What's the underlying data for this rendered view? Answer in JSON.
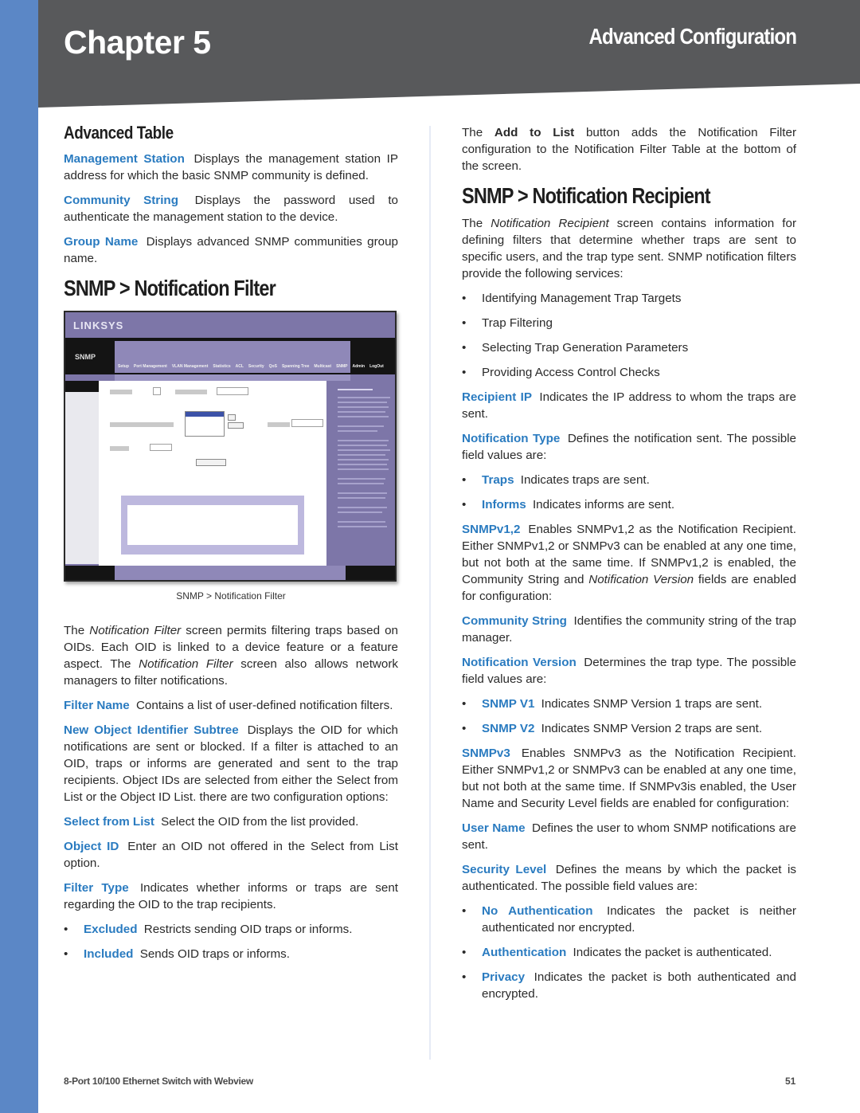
{
  "header": {
    "chapter": "Chapter 5",
    "section": "Advanced Configuration",
    "colors": {
      "band": "#58595b",
      "sidebar": "#5b87c6",
      "term": "#2a7bc0"
    }
  },
  "left": {
    "advanced_table": {
      "heading": "Advanced Table",
      "items": [
        {
          "term": "Management Station",
          "text": "Displays the management station IP address for which the basic SNMP community is defined."
        },
        {
          "term": "Community String",
          "text": "Displays the password used to authenticate the management station to the device."
        },
        {
          "term": "Group Name",
          "text": "Displays advanced SNMP communities group name."
        }
      ]
    },
    "notification_filter": {
      "heading": "SNMP > Notification Filter",
      "figure_caption": "SNMP > Notification Filter",
      "screenshot": {
        "logo": "LINKSYS",
        "page_label": "SNMP",
        "nav": [
          "Setup",
          "Port Management",
          "VLAN Management",
          "Statistics",
          "ACL",
          "Security",
          "QoS",
          "Spanning Tree",
          "Multicast",
          "SNMP",
          "Admin",
          "LogOut"
        ]
      },
      "intro": {
        "p1": "The ",
        "em1": "Notification Filter",
        "p2": " screen permits filtering traps based on OIDs. Each OID is linked to a device feature or a feature aspect. The ",
        "em2": "Notification Filter",
        "p3": " screen also allows network managers to filter notifications."
      },
      "items": [
        {
          "term": "Filter Name",
          "text": "Contains a list of user-defined notification filters."
        },
        {
          "term": "New Object Identifier Subtree",
          "text": "Displays the OID for which notifications are sent or blocked. If a filter is attached to an OID, traps or informs are generated and sent to the trap recipients. Object IDs are selected from either the Select from List or the Object ID List. there are two configuration options:"
        },
        {
          "term": "Select from List",
          "text": "Select the OID from the list provided."
        },
        {
          "term": "Object ID",
          "text": "Enter an OID not offered in the Select from List option."
        },
        {
          "term": "Filter Type",
          "text": "Indicates whether informs or traps are sent regarding the OID to the trap recipients."
        }
      ],
      "filter_type_bullets": [
        {
          "term": "Excluded",
          "text": "Restricts sending OID traps or informs."
        },
        {
          "term": "Included",
          "text": "Sends OID traps or informs."
        }
      ]
    }
  },
  "right": {
    "add_to_list": {
      "p1": "The ",
      "bold": "Add to List",
      "p2": " button adds the Notification Filter configuration to the Notification Filter Table at the bottom of the screen."
    },
    "recipient": {
      "heading": "SNMP > Notification Recipient",
      "intro": {
        "p1": "The ",
        "em": "Notification Recipient",
        "p2": " screen contains information for defining filters that determine whether traps are sent to specific users, and the trap type sent. SNMP notification filters provide the following services:"
      },
      "services": [
        "Identifying Management Trap Targets",
        "Trap Filtering",
        "Selecting Trap Generation Parameters",
        "Providing Access Control Checks"
      ],
      "recipient_ip": {
        "term": "Recipient IP",
        "text": "Indicates the IP address to whom the traps are sent."
      },
      "notification_type": {
        "term": "Notification Type",
        "text": "Defines the notification sent. The possible field values are:"
      },
      "notification_type_bullets": [
        {
          "term": "Traps",
          "text": "Indicates traps are sent."
        },
        {
          "term": "Informs",
          "text": "Indicates informs are sent."
        }
      ],
      "snmpv12": {
        "term": "SNMPv1,2",
        "p1": "Enables SNMPv1,2 as the Notification Recipient. Either SNMPv1,2 or SNMPv3 can be enabled at any one time, but not both at the same time. If SNMPv1,2 is enabled, the Community String and ",
        "em": "Notification Version",
        "p2": " fields are enabled for configuration:"
      },
      "community_string": {
        "term": "Community String",
        "text": "Identifies the community string of the trap manager."
      },
      "notification_version": {
        "term": "Notification Version",
        "text": "Determines the trap type. The possible field values are:"
      },
      "version_bullets": [
        {
          "term": "SNMP V1",
          "text": "Indicates SNMP Version 1 traps are sent."
        },
        {
          "term": "SNMP V2",
          "text": "Indicates SNMP Version 2 traps are sent."
        }
      ],
      "snmpv3": {
        "term": "SNMPv3",
        "text": "Enables SNMPv3 as the Notification Recipient. Either SNMPv1,2 or SNMPv3 can be enabled at any one time, but not both at the same time. If SNMPv3is enabled, the User Name and Security Level fields are enabled for configuration:"
      },
      "user_name": {
        "term": "User Name",
        "text": "Defines the user to whom SNMP notifications are sent."
      },
      "security_level": {
        "term": "Security Level",
        "text": "Defines the means by which the packet is authenticated. The possible field values are:"
      },
      "security_bullets": [
        {
          "term": "No Authentication",
          "text": "Indicates the packet is neither authenticated nor encrypted."
        },
        {
          "term": "Authentication",
          "text": "Indicates the packet is authenticated."
        },
        {
          "term": "Privacy",
          "text": "Indicates the packet is both authenticated and encrypted."
        }
      ]
    }
  },
  "footer": {
    "product": "8-Port 10/100 Ethernet Switch with Webview",
    "page": "51"
  },
  "bullet_glyph": "•"
}
